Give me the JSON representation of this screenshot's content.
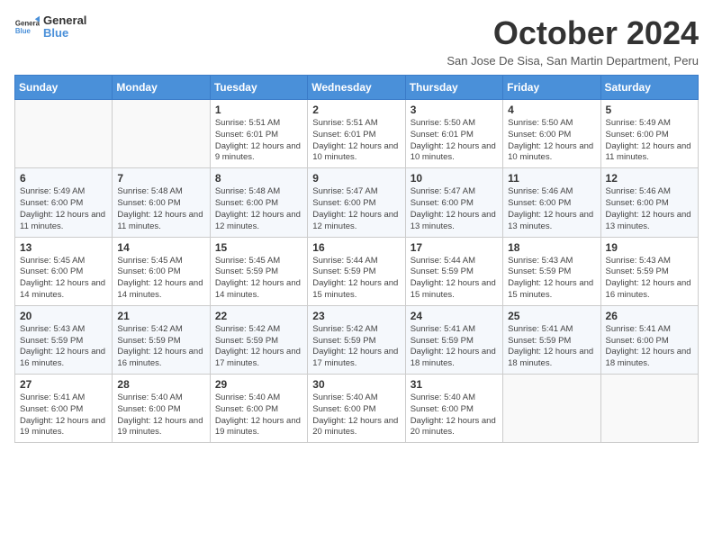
{
  "logo": {
    "text_general": "General",
    "text_blue": "Blue"
  },
  "header": {
    "title": "October 2024",
    "subtitle": "San Jose De Sisa, San Martin Department, Peru"
  },
  "weekdays": [
    "Sunday",
    "Monday",
    "Tuesday",
    "Wednesday",
    "Thursday",
    "Friday",
    "Saturday"
  ],
  "weeks": [
    [
      {
        "day": "",
        "info": ""
      },
      {
        "day": "",
        "info": ""
      },
      {
        "day": "1",
        "info": "Sunrise: 5:51 AM\nSunset: 6:01 PM\nDaylight: 12 hours and 9 minutes."
      },
      {
        "day": "2",
        "info": "Sunrise: 5:51 AM\nSunset: 6:01 PM\nDaylight: 12 hours and 10 minutes."
      },
      {
        "day": "3",
        "info": "Sunrise: 5:50 AM\nSunset: 6:01 PM\nDaylight: 12 hours and 10 minutes."
      },
      {
        "day": "4",
        "info": "Sunrise: 5:50 AM\nSunset: 6:00 PM\nDaylight: 12 hours and 10 minutes."
      },
      {
        "day": "5",
        "info": "Sunrise: 5:49 AM\nSunset: 6:00 PM\nDaylight: 12 hours and 11 minutes."
      }
    ],
    [
      {
        "day": "6",
        "info": "Sunrise: 5:49 AM\nSunset: 6:00 PM\nDaylight: 12 hours and 11 minutes."
      },
      {
        "day": "7",
        "info": "Sunrise: 5:48 AM\nSunset: 6:00 PM\nDaylight: 12 hours and 11 minutes."
      },
      {
        "day": "8",
        "info": "Sunrise: 5:48 AM\nSunset: 6:00 PM\nDaylight: 12 hours and 12 minutes."
      },
      {
        "day": "9",
        "info": "Sunrise: 5:47 AM\nSunset: 6:00 PM\nDaylight: 12 hours and 12 minutes."
      },
      {
        "day": "10",
        "info": "Sunrise: 5:47 AM\nSunset: 6:00 PM\nDaylight: 12 hours and 13 minutes."
      },
      {
        "day": "11",
        "info": "Sunrise: 5:46 AM\nSunset: 6:00 PM\nDaylight: 12 hours and 13 minutes."
      },
      {
        "day": "12",
        "info": "Sunrise: 5:46 AM\nSunset: 6:00 PM\nDaylight: 12 hours and 13 minutes."
      }
    ],
    [
      {
        "day": "13",
        "info": "Sunrise: 5:45 AM\nSunset: 6:00 PM\nDaylight: 12 hours and 14 minutes."
      },
      {
        "day": "14",
        "info": "Sunrise: 5:45 AM\nSunset: 6:00 PM\nDaylight: 12 hours and 14 minutes."
      },
      {
        "day": "15",
        "info": "Sunrise: 5:45 AM\nSunset: 5:59 PM\nDaylight: 12 hours and 14 minutes."
      },
      {
        "day": "16",
        "info": "Sunrise: 5:44 AM\nSunset: 5:59 PM\nDaylight: 12 hours and 15 minutes."
      },
      {
        "day": "17",
        "info": "Sunrise: 5:44 AM\nSunset: 5:59 PM\nDaylight: 12 hours and 15 minutes."
      },
      {
        "day": "18",
        "info": "Sunrise: 5:43 AM\nSunset: 5:59 PM\nDaylight: 12 hours and 15 minutes."
      },
      {
        "day": "19",
        "info": "Sunrise: 5:43 AM\nSunset: 5:59 PM\nDaylight: 12 hours and 16 minutes."
      }
    ],
    [
      {
        "day": "20",
        "info": "Sunrise: 5:43 AM\nSunset: 5:59 PM\nDaylight: 12 hours and 16 minutes."
      },
      {
        "day": "21",
        "info": "Sunrise: 5:42 AM\nSunset: 5:59 PM\nDaylight: 12 hours and 16 minutes."
      },
      {
        "day": "22",
        "info": "Sunrise: 5:42 AM\nSunset: 5:59 PM\nDaylight: 12 hours and 17 minutes."
      },
      {
        "day": "23",
        "info": "Sunrise: 5:42 AM\nSunset: 5:59 PM\nDaylight: 12 hours and 17 minutes."
      },
      {
        "day": "24",
        "info": "Sunrise: 5:41 AM\nSunset: 5:59 PM\nDaylight: 12 hours and 18 minutes."
      },
      {
        "day": "25",
        "info": "Sunrise: 5:41 AM\nSunset: 5:59 PM\nDaylight: 12 hours and 18 minutes."
      },
      {
        "day": "26",
        "info": "Sunrise: 5:41 AM\nSunset: 6:00 PM\nDaylight: 12 hours and 18 minutes."
      }
    ],
    [
      {
        "day": "27",
        "info": "Sunrise: 5:41 AM\nSunset: 6:00 PM\nDaylight: 12 hours and 19 minutes."
      },
      {
        "day": "28",
        "info": "Sunrise: 5:40 AM\nSunset: 6:00 PM\nDaylight: 12 hours and 19 minutes."
      },
      {
        "day": "29",
        "info": "Sunrise: 5:40 AM\nSunset: 6:00 PM\nDaylight: 12 hours and 19 minutes."
      },
      {
        "day": "30",
        "info": "Sunrise: 5:40 AM\nSunset: 6:00 PM\nDaylight: 12 hours and 20 minutes."
      },
      {
        "day": "31",
        "info": "Sunrise: 5:40 AM\nSunset: 6:00 PM\nDaylight: 12 hours and 20 minutes."
      },
      {
        "day": "",
        "info": ""
      },
      {
        "day": "",
        "info": ""
      }
    ]
  ]
}
